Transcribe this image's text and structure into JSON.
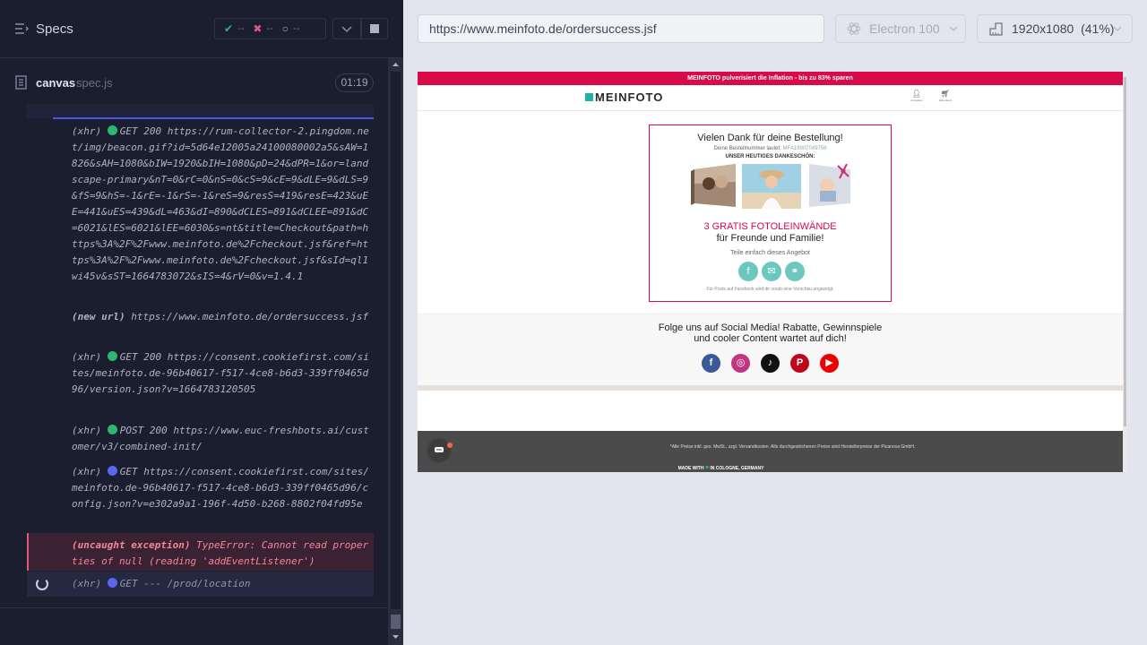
{
  "runner": {
    "title": "Specs",
    "stats": {
      "passed": "--",
      "failed": "--",
      "pending": "--"
    },
    "spec": {
      "name": "canvas",
      "ext": "spec.js",
      "time": "01:19"
    },
    "log": [
      {
        "kind": "(xhr)",
        "method": "GET 200",
        "url": "https://rum-collector-2.pingdom.net/img/beacon.gif?id=5d64e12005a24100080002a5&sAW=1826&sAH=1080&bIW=1920&bIH=1080&pD=24&dPR=1&or=landscape-primary&nT=0&rC=0&nS=0&cS=9&cE=9&dLE=9&dLS=9&fS=9&hS=-1&rE=-1&rS=-1&reS=9&resS=419&resE=423&uEE=441&uES=439&dL=463&dI=890&dCLES=891&dCLEE=891&dC=6021&lES=6021&lEE=6030&s=nt&title=Checkout&path=https%3A%2F%2Fwww.meinfoto.de%2Fcheckout.jsf&ref=https%3A%2F%2Fwww.meinfoto.de%2Fcheckout.jsf&sId=ql1wi45v&sST=1664783072&sIS=4&rV=0&v=1.4.1"
      },
      {
        "kind": "(new url)",
        "method": "",
        "url": "https://www.meinfoto.de/ordersuccess.jsf"
      },
      {
        "kind": "(xhr)",
        "method": "GET 200",
        "url": "https://consent.cookiefirst.com/sites/meinfoto.de-96b40617-f517-4ce8-b6d3-339ff0465d96/version.json?v=1664783120505"
      },
      {
        "kind": "(xhr)",
        "method": "POST 200",
        "url": "https://www.euc-freshbots.ai/customer/v3/combined-init/"
      },
      {
        "kind": "(xhr)",
        "method": "GET",
        "url": "https://consent.cookiefirst.com/sites/meinfoto.de-96b40617-f517-4ce8-b6d3-339ff0465d96/config.json?v=e302a9a1-196f-4d50-b268-8802f04fd95e"
      }
    ],
    "error": {
      "kind": "(uncaught exception)",
      "message": "TypeError: Cannot read properties of null (reading 'addEventListener')"
    },
    "pending": {
      "kind": "(xhr)",
      "method": "GET",
      "url": "--- /prod/location"
    }
  },
  "toolbar": {
    "url": "https://www.meinfoto.de/ordersuccess.jsf",
    "browser": "Electron 100",
    "viewport": "1920x1080",
    "zoom": "(41%)"
  },
  "site": {
    "banner": "MEINFOTO pulverisiert die Inflation - bis zu 83% sparen",
    "logo": "MEINFOTO",
    "account_label": "Anmelden",
    "cart_label": "Warenkorb",
    "thanks": "Vielen Dank für deine Bestellung!",
    "order_label": "Deine Bestellnummer lautet:",
    "order_number": "MFA19907049756",
    "gift": "UNSER HEUTIGES DANKESCHÖN:",
    "promo_line1": "3 GRATIS FOTOLEINWÄNDE",
    "promo_line2": "für Freunde und Familie!",
    "share_text": "Teile einfach dieses Angebot",
    "fb_note": "Für Posts auf Facebook wird dir vorab eine Vorschau angezeigt.",
    "follow_line1": "Folge uns auf Social Media! Rabatte, Gewinnspiele",
    "follow_line2": "und cooler Content wartet auf dich!",
    "footer_note": "*Alle Preise inkl. ges. MwSt., zzgl. Versandkosten. Alle durchgestrichenen Preise sind Herstellerpreise der Picanova GmbH.",
    "made_in": "MADE WITH",
    "made_place": "IN COLOGNE, GERMANY",
    "colors": {
      "brand": "#d90a48",
      "teal": "#20b2a5"
    }
  }
}
